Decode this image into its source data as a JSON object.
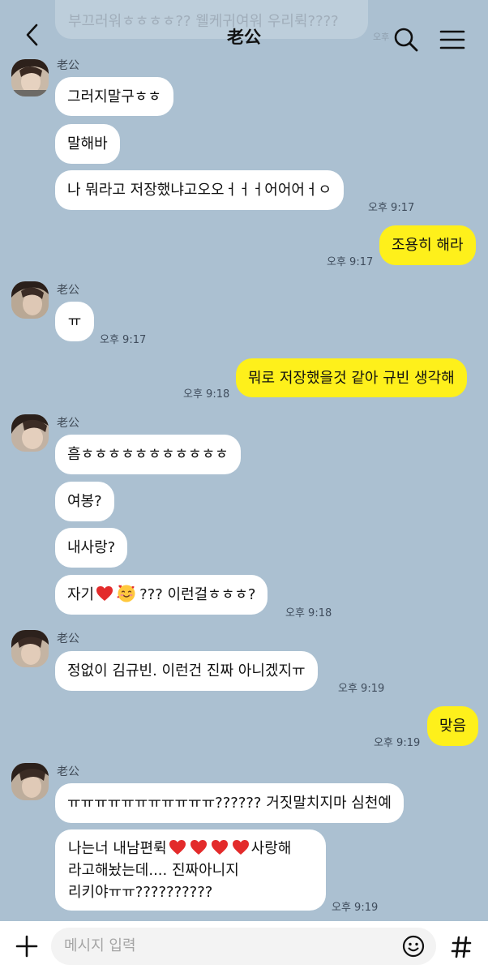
{
  "header": {
    "title": "老公",
    "prev_message": "부끄러워ㅎㅎㅎㅎ?? 웰케귀여워 우리뤽????",
    "prev_time": "오후"
  },
  "messages": [
    {
      "type": "sender",
      "name": "老公"
    },
    {
      "type": "in",
      "text": "그러지말구ㅎㅎ"
    },
    {
      "type": "in",
      "text": "말해바"
    },
    {
      "type": "in",
      "text": "나 뭐라고 저장했냐고오오ㅓㅓㅓ어어어ㅓㅇ",
      "time": "오후 9:17"
    },
    {
      "type": "out",
      "text": "조용히 해라",
      "time": "오후 9:17"
    },
    {
      "type": "sender",
      "name": "老公"
    },
    {
      "type": "in",
      "text": "ㅠ",
      "time": "오후 9:17"
    },
    {
      "type": "out",
      "text": "뭐로 저장했을것 같아 규빈 생각해",
      "time": "오후 9:18"
    },
    {
      "type": "sender",
      "name": "老公"
    },
    {
      "type": "in",
      "text": "흠ㅎㅎㅎㅎㅎㅎㅎㅎㅎㅎㅎ"
    },
    {
      "type": "in",
      "text": "여봉?"
    },
    {
      "type": "in",
      "text": "내사랑?"
    },
    {
      "type": "in",
      "text_a": "자기",
      "text_b": "??? 이런걸ㅎㅎㅎ?",
      "emojis": [
        "red-heart",
        "smiling-face-with-hearts"
      ],
      "time": "오후 9:18"
    },
    {
      "type": "sender",
      "name": "老公"
    },
    {
      "type": "in",
      "text": "정없이 김규빈. 이런건 진짜 아니겠지ㅠ",
      "time": "오후 9:19"
    },
    {
      "type": "out",
      "text": "맞음",
      "time": "오후 9:19"
    },
    {
      "type": "sender",
      "name": "老公"
    },
    {
      "type": "in",
      "text": "ㅠㅠㅠㅠㅠㅠㅠㅠㅠㅠㅠ?????? 거짓말치지마 심천예"
    },
    {
      "type": "in",
      "line1_a": "나는너 내남편뤽",
      "line1_b": "사랑해",
      "line2": "라고해놨는데.... 진짜아니지",
      "line3": "리키야ㅠㅠ??????????",
      "emojis": [
        "red-heart",
        "red-heart",
        "red-heart",
        "red-heart"
      ],
      "time": "오후 9:19"
    }
  ],
  "input": {
    "placeholder": "메시지 입력"
  },
  "icons": {
    "back": "chevron-left-icon",
    "search": "search-icon",
    "menu": "hamburger-menu-icon",
    "plus": "plus-icon",
    "emoji": "emoji-icon",
    "hash": "hash-icon"
  },
  "colors": {
    "background": "#abc0d1",
    "incoming_bubble": "#ffffff",
    "outgoing_bubble": "#fef01b",
    "heart": "#e32b2b"
  }
}
